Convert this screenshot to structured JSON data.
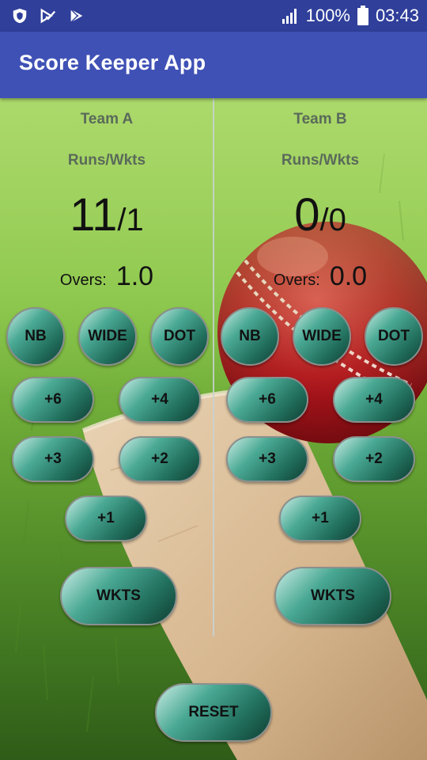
{
  "status_bar": {
    "battery": "100%",
    "time": "03:43",
    "icons": [
      "shield-icon",
      "check-notification-icon",
      "play-store-icon",
      "signal-icon",
      "battery-icon"
    ]
  },
  "app_bar": {
    "title": "Score Keeper App",
    "color": "#3f51b5"
  },
  "team_a": {
    "name": "Team A",
    "runs_label": "Runs/Wkts",
    "runs": "11",
    "wickets": "/1",
    "overs_label": "Overs:",
    "overs": "1.0",
    "buttons": {
      "nb": "NB",
      "wide": "WIDE",
      "dot": "DOT",
      "six": "+6",
      "four": "+4",
      "three": "+3",
      "two": "+2",
      "one": "+1",
      "wkts": "WKTS"
    }
  },
  "team_b": {
    "name": "Team B",
    "runs_label": "Runs/Wkts",
    "runs": "0",
    "wickets": "/0",
    "overs_label": "Overs:",
    "overs": "0.0",
    "buttons": {
      "nb": "NB",
      "wide": "WIDE",
      "dot": "DOT",
      "six": "+6",
      "four": "+4",
      "three": "+3",
      "two": "+2",
      "one": "+1",
      "wkts": "WKTS"
    }
  },
  "reset_label": "RESET"
}
